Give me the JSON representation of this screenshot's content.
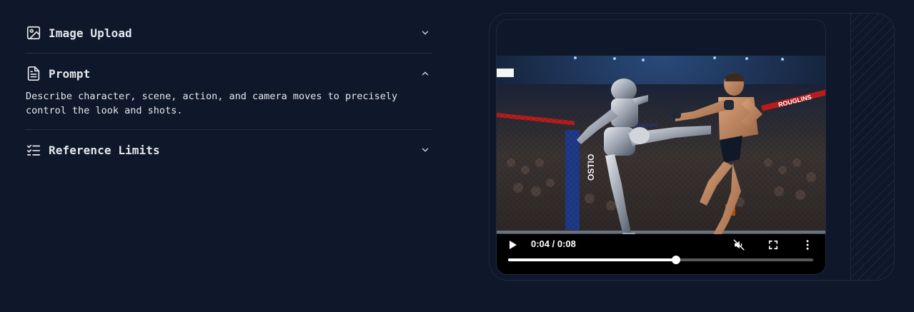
{
  "accordion": {
    "items": [
      {
        "title": "Image Upload",
        "icon": "image-icon",
        "expanded": false,
        "chevron": "chevron-down-icon"
      },
      {
        "title": "Prompt",
        "icon": "document-icon",
        "expanded": true,
        "chevron": "chevron-up-icon",
        "body": "Describe character, scene, action, and camera moves to precisely control the look and shots."
      },
      {
        "title": "Reference Limits",
        "icon": "checklist-icon",
        "expanded": false,
        "chevron": "chevron-down-icon"
      }
    ]
  },
  "video": {
    "current_time": "0:04",
    "duration": "0:08",
    "time_display": "0:04 / 0:08",
    "progress": 0.55,
    "muted": true,
    "icons": {
      "play": "play-icon",
      "mute": "muted-speaker-icon",
      "fullscreen": "fullscreen-icon",
      "more": "more-vertical-icon"
    }
  },
  "colors": {
    "background": "#0f172a",
    "divider": "#223049",
    "text": "#e5e7eb",
    "panel_border": "#1e2a3f"
  }
}
